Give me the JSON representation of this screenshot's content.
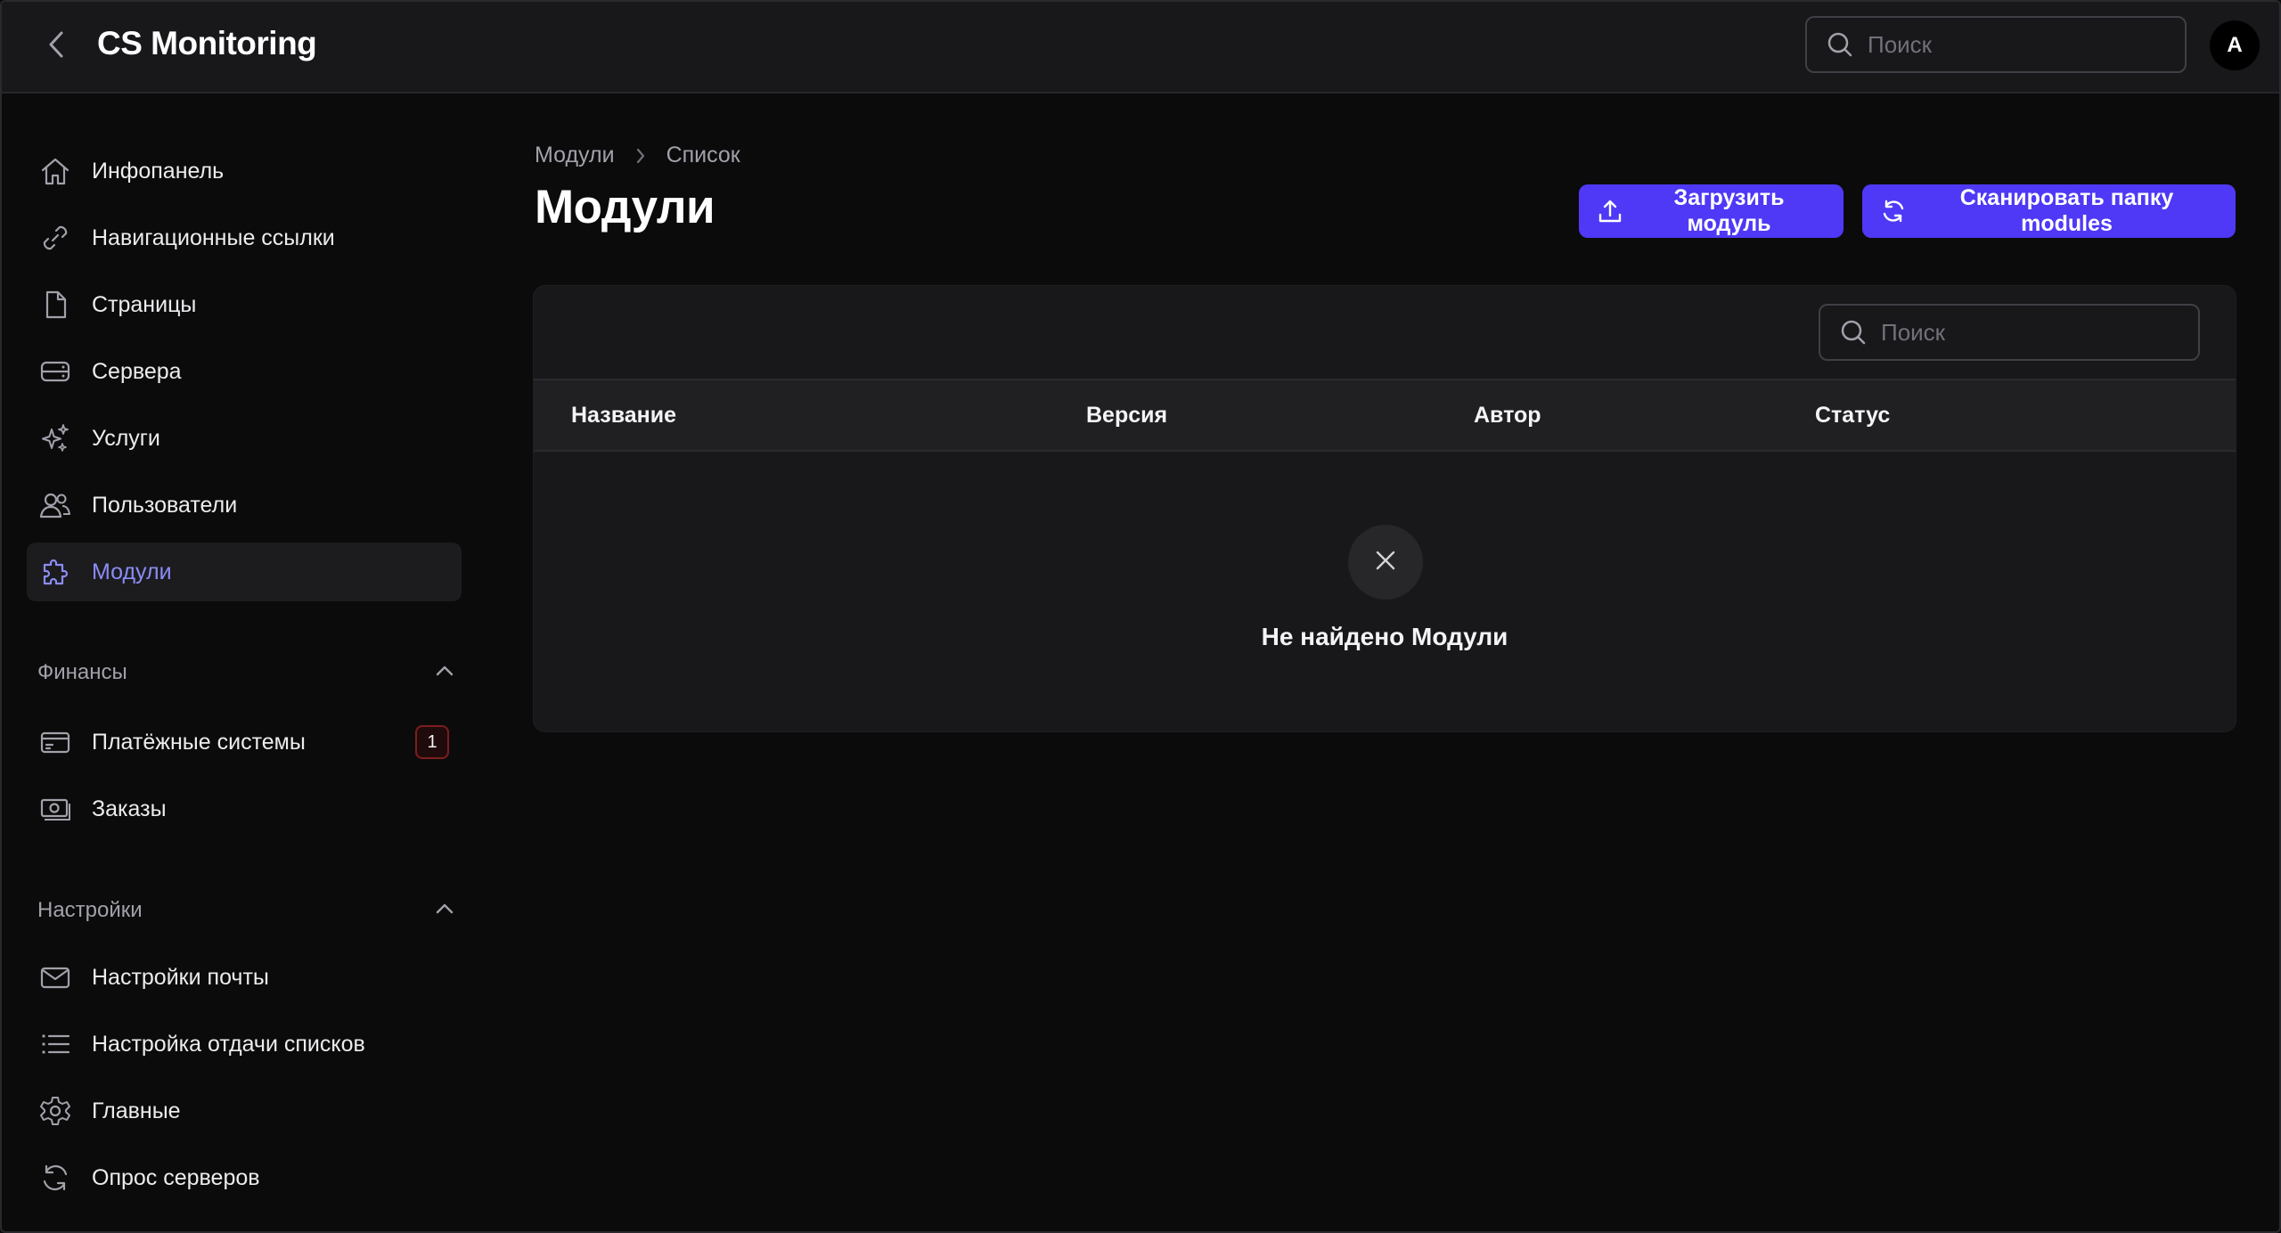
{
  "app": {
    "title": "CS Monitoring"
  },
  "header": {
    "search_placeholder": "Поиск",
    "avatar_initial": "A"
  },
  "sidebar": {
    "main_items": [
      {
        "label": "Инфопанель",
        "icon": "home-icon"
      },
      {
        "label": "Навигационные ссылки",
        "icon": "link-icon"
      },
      {
        "label": "Страницы",
        "icon": "document-icon"
      },
      {
        "label": "Сервера",
        "icon": "server-icon"
      },
      {
        "label": "Услуги",
        "icon": "sparkles-icon"
      },
      {
        "label": "Пользователи",
        "icon": "users-icon"
      },
      {
        "label": "Модули",
        "icon": "puzzle-icon",
        "active": true
      }
    ],
    "finance": {
      "label": "Финансы",
      "items": [
        {
          "label": "Платёжные системы",
          "icon": "credit-card-icon",
          "badge": "1"
        },
        {
          "label": "Заказы",
          "icon": "banknote-icon"
        }
      ]
    },
    "settings": {
      "label": "Настройки",
      "items": [
        {
          "label": "Настройки почты",
          "icon": "mail-icon"
        },
        {
          "label": "Настройка отдачи списков",
          "icon": "list-icon"
        },
        {
          "label": "Главные",
          "icon": "gear-icon"
        },
        {
          "label": "Опрос серверов",
          "icon": "refresh-icon"
        }
      ]
    }
  },
  "breadcrumb": {
    "parent": "Модули",
    "current": "Список"
  },
  "page": {
    "title": "Модули",
    "upload_label": "Загрузить модуль",
    "scan_label": "Сканировать папку modules"
  },
  "table": {
    "search_placeholder": "Поиск",
    "columns": [
      "Название",
      "Версия",
      "Автор",
      "Статус"
    ],
    "empty_text": "Не найдено Модули"
  },
  "colors": {
    "accent": "#4f39f6",
    "active_text": "#8b8cf6",
    "background": "#0b0b0c",
    "surface": "#18181b"
  }
}
